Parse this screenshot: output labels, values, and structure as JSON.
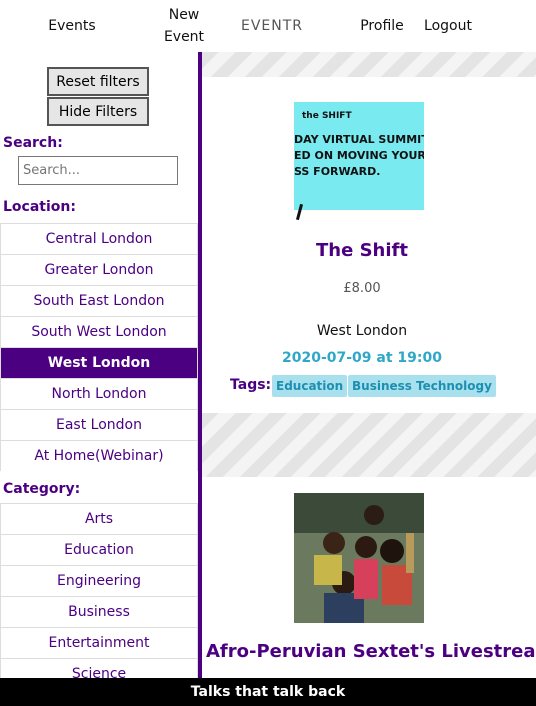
{
  "nav": {
    "events": "Events",
    "new_event": "New Event",
    "brand": "EVENTR",
    "profile": "Profile",
    "logout": "Logout"
  },
  "sidebar": {
    "reset_filters": "Reset filters",
    "hide_filters": "Hide Filters",
    "search_label": "Search:",
    "search_placeholder": "Search...",
    "location_label": "Location:",
    "locations": [
      "Central London",
      "Greater London",
      "South East London",
      "South West London",
      "West London",
      "North London",
      "East London",
      "At Home(Webinar)"
    ],
    "active_location": "West London",
    "category_label": "Category:",
    "categories": [
      "Arts",
      "Education",
      "Engineering",
      "Business",
      "Entertainment",
      "Science"
    ]
  },
  "events": [
    {
      "image_text_brand": "the SHIFT",
      "image_text_lines": [
        "DAY VIRTUAL SUMMIT",
        "ED ON MOVING YOUR",
        "SS FORWARD."
      ],
      "title": "The Shift",
      "price": "£8.00",
      "location": "West London",
      "datetime": "2020-07-09 at 19:00",
      "tags_label": "Tags:",
      "tags": [
        "Education",
        "Business",
        "Technology"
      ]
    },
    {
      "title": "Afro-Peruvian Sextet's Livestreaming"
    }
  ],
  "footer": {
    "tagline": "Talks that talk back"
  },
  "colors": {
    "accent": "#4b0082",
    "date": "#2fa8c7",
    "tag_bg": "#a8e0ee"
  }
}
